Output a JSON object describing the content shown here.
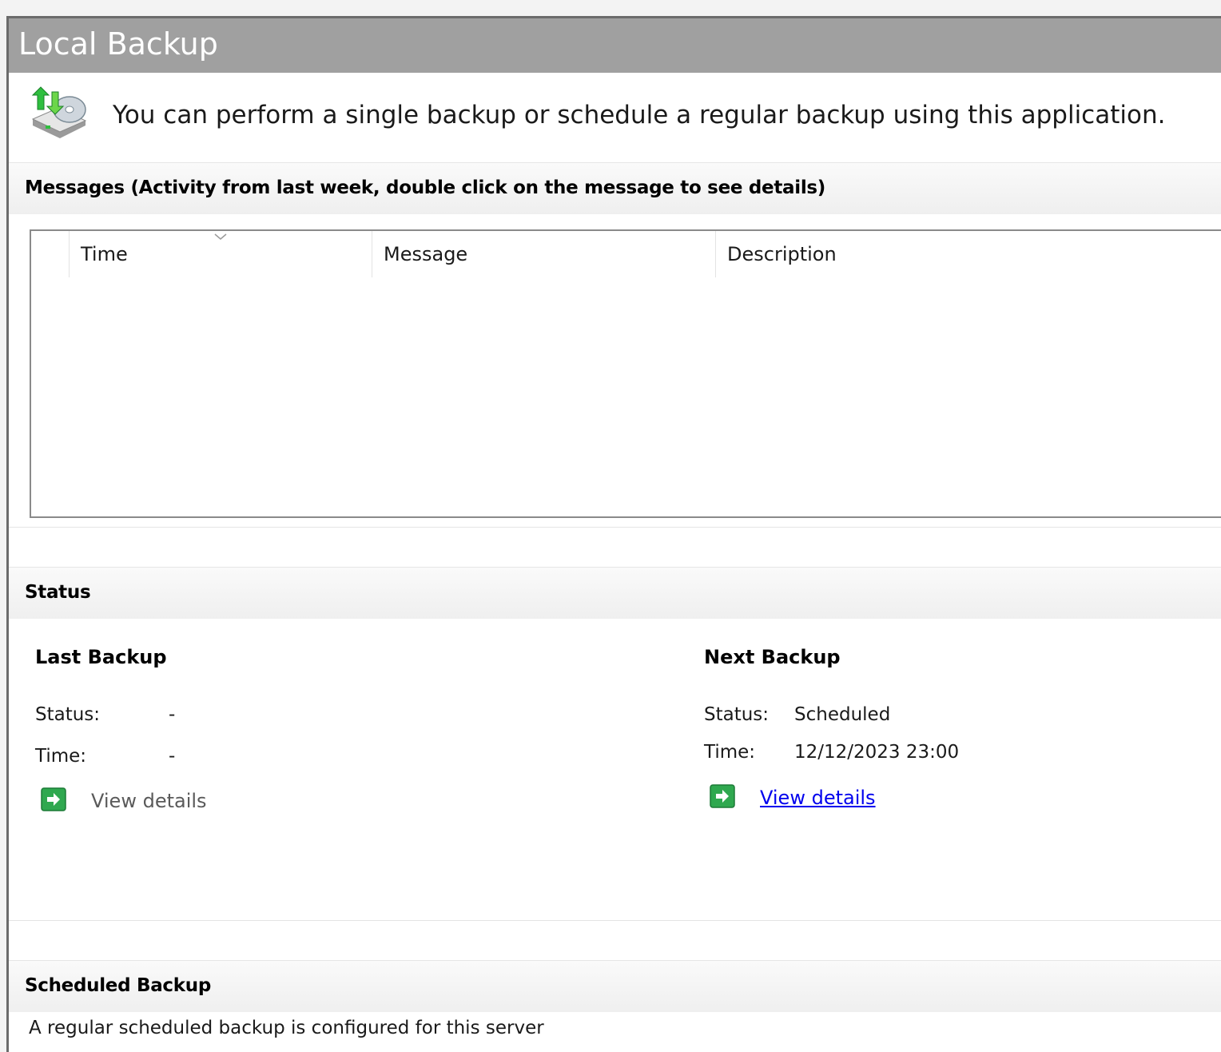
{
  "window": {
    "title": "Local Backup"
  },
  "intro": {
    "icon": "backup-drive-icon",
    "description": "You can perform a single backup or schedule a regular backup using this application."
  },
  "messages": {
    "header": "Messages (Activity from last week, double click on the message to see details)",
    "columns": [
      "Time",
      "Message",
      "Description"
    ],
    "sort_column": "Time",
    "rows": []
  },
  "status": {
    "header": "Status",
    "last_backup": {
      "title": "Last Backup",
      "status_label": "Status:",
      "status_value": "-",
      "time_label": "Time:",
      "time_value": "-",
      "details_label": "View details"
    },
    "next_backup": {
      "title": "Next Backup",
      "status_label": "Status:",
      "status_value": "Scheduled",
      "time_label": "Time:",
      "time_value": "12/12/2023 23:00",
      "details_label": "View details"
    }
  },
  "scheduled_backup": {
    "header": "Scheduled Backup",
    "text": "A regular scheduled backup is configured for this server"
  },
  "colors": {
    "titlebar": "#a0a0a0",
    "link": "#0000ee",
    "go_icon": "#2fa84f"
  }
}
